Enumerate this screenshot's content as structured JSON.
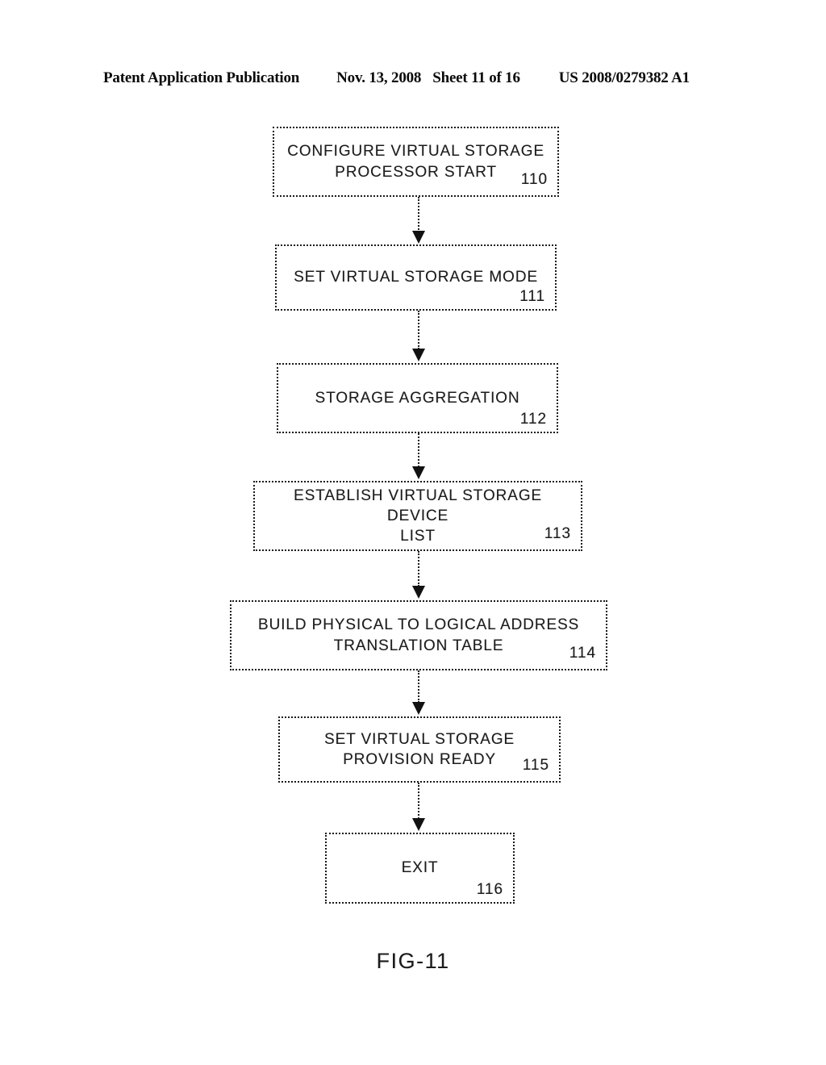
{
  "header": {
    "publication": "Patent Application Publication",
    "date": "Nov. 13, 2008",
    "sheet": "Sheet 11 of 16",
    "pub_number": "US 2008/0279382 A1"
  },
  "figure": {
    "caption": "FIG-11",
    "ink_color": "#1a1a1a",
    "background_color": "#ffffff"
  },
  "flowchart": {
    "nodes": [
      {
        "id": "n110",
        "label": "CONFIGURE VIRTUAL STORAGE\nPROCESSOR START",
        "ref": "110"
      },
      {
        "id": "n111",
        "label": "SET VIRTUAL STORAGE MODE",
        "ref": "111"
      },
      {
        "id": "n112",
        "label": "STORAGE AGGREGATION",
        "ref": "112"
      },
      {
        "id": "n113",
        "label": "ESTABLISH VIRTUAL STORAGE DEVICE\nLIST",
        "ref": "113"
      },
      {
        "id": "n114",
        "label": "BUILD PHYSICAL TO LOGICAL ADDRESS\nTRANSLATION TABLE",
        "ref": "114"
      },
      {
        "id": "n115",
        "label": "SET VIRTUAL STORAGE\nPROVISION READY",
        "ref": "115"
      },
      {
        "id": "n116",
        "label": "EXIT",
        "ref": "116"
      }
    ],
    "edges": [
      {
        "from": "110",
        "to": "111"
      },
      {
        "from": "111",
        "to": "112"
      },
      {
        "from": "112",
        "to": "113"
      },
      {
        "from": "113",
        "to": "114"
      },
      {
        "from": "114",
        "to": "115"
      },
      {
        "from": "115",
        "to": "116"
      }
    ]
  }
}
